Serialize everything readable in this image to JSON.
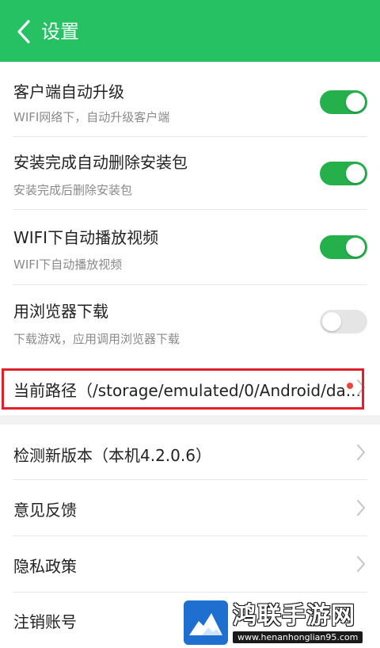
{
  "header": {
    "title": "设置",
    "back_icon": "chevron-left-icon"
  },
  "settings": [
    {
      "title": "客户端自动升级",
      "subtitle": "WIFI网络下，自动升级客户端",
      "enabled": true
    },
    {
      "title": "安装完成自动删除安装包",
      "subtitle": "安装完成后删除安装包",
      "enabled": true
    },
    {
      "title": "WIFI下自动播放视频",
      "subtitle": "WIFI下自动播放视频",
      "enabled": true
    },
    {
      "title": "用浏览器下载",
      "subtitle": "下载游戏，应用调用浏览器下载",
      "enabled": false
    }
  ],
  "path_row": {
    "title": "当前路径（/storage/emulated/0/Android/da..."
  },
  "menu": [
    {
      "title": "检测新版本（本机4.2.0.6）"
    },
    {
      "title": "意见反馈"
    },
    {
      "title": "隐私政策"
    },
    {
      "title": "注销账号"
    }
  ],
  "watermark": {
    "name": "鸿联手游网",
    "url": "www.henanhonglian95.com"
  },
  "colors": {
    "accent": "#25c163",
    "toggle_on": "#25b04c",
    "toggle_off": "#e5e5e5",
    "highlight": "#e0202a",
    "dot": "#e8473f"
  }
}
